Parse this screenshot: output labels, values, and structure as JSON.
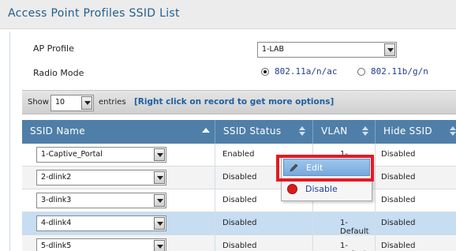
{
  "header": {
    "title": "Access Point Profiles SSID List"
  },
  "form": {
    "ap_profile_label": "AP Profile",
    "ap_profile_value": "1-LAB",
    "radio_mode_label": "Radio Mode",
    "radio_options": [
      "802.11a/n/ac",
      "802.11b/g/n"
    ],
    "radio_selected": "802.11a/n/ac"
  },
  "toolbar": {
    "show_label": "Show",
    "entries_value": "10",
    "entries_label": "entries",
    "hint": "[Right click on record to get more options]"
  },
  "table": {
    "columns": [
      "SSID Name",
      "SSID Status",
      "VLAN",
      "Hide SSID"
    ],
    "rows": [
      {
        "name": "1-Captive_Portal",
        "status": "Enabled",
        "vlan": "1-Default",
        "hide": "Disabled"
      },
      {
        "name": "2-dlink2",
        "status": "Disabled",
        "vlan": "",
        "hide": "Disabled"
      },
      {
        "name": "3-dlink3",
        "status": "Disabled",
        "vlan": "",
        "hide": "Disabled"
      },
      {
        "name": "4-dlink4",
        "status": "Disabled",
        "vlan": "1-Default",
        "hide": "Disabled"
      },
      {
        "name": "5-dlink5",
        "status": "Disabled",
        "vlan": "1-Default",
        "hide": "Disabled"
      }
    ]
  },
  "context_menu": {
    "items": [
      "Edit",
      "Disable"
    ]
  },
  "icons": {
    "menu_edit": "pencil-icon",
    "menu_disable": "stop-icon",
    "sort": "sort-arrow-icon"
  },
  "colors": {
    "header_blue": "#4f7fa8",
    "title_blue": "#1f5f8f",
    "highlight_red": "#e21b23",
    "selected_row": "#c6ddf2"
  }
}
